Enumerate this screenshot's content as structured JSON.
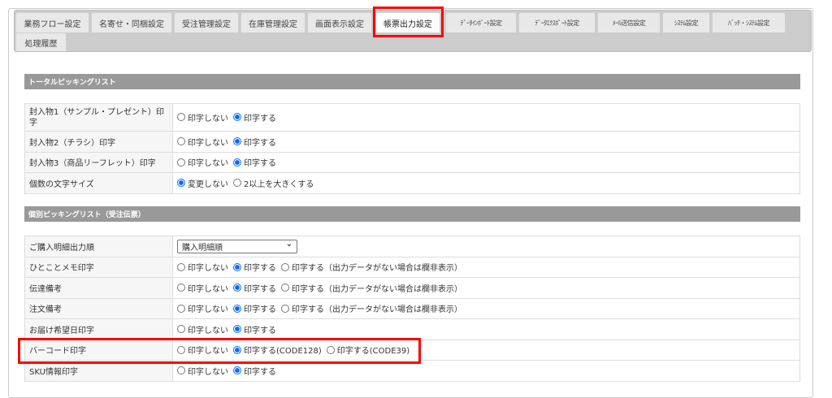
{
  "tabs": [
    {
      "label": "業務フロー設定"
    },
    {
      "label": "名寄せ・同梱設定"
    },
    {
      "label": "受注管理設定"
    },
    {
      "label": "在庫管理設定"
    },
    {
      "label": "画面表示設定"
    },
    {
      "label": "帳票出力設定",
      "active": true
    },
    {
      "label": "ﾃﾞｰﾀｲﾝﾎﾟｰﾄ設定"
    },
    {
      "label": "ﾃﾞｰﾀｴｸｽﾎﾟｰﾄ設定"
    },
    {
      "label": "ﾒｰﾙ送信設定"
    },
    {
      "label": "ｼｽﾃﾑ設定"
    },
    {
      "label": "ﾊﾞｯﾁ・ｼｽﾃﾑ設定"
    },
    {
      "label": "処理履歴"
    }
  ],
  "section1": {
    "title": "トータルピッキングリスト",
    "rows": [
      {
        "label": "封入物1（サンプル・プレゼント）印字",
        "options": [
          "印字しない",
          "印字する"
        ],
        "selected": 1
      },
      {
        "label": "封入物2（チラシ）印字",
        "options": [
          "印字しない",
          "印字する"
        ],
        "selected": 1
      },
      {
        "label": "封入物3（商品リーフレット）印字",
        "options": [
          "印字しない",
          "印字する"
        ],
        "selected": 1
      },
      {
        "label": "個数の文字サイズ",
        "options": [
          "変更しない",
          "2以上を大きくする"
        ],
        "selected": 0
      }
    ]
  },
  "section2": {
    "title": "個別ピッキングリスト（受注伝票）",
    "rows": [
      {
        "label": "ご購入明細出力順",
        "select": "購入明細順"
      },
      {
        "label": "ひとことメモ印字",
        "options": [
          "印字しない",
          "印字する",
          "印字する（出力データがない場合は欄非表示）"
        ],
        "selected": 1
      },
      {
        "label": "伝達備考",
        "options": [
          "印字しない",
          "印字する",
          "印字する（出力データがない場合は欄非表示）"
        ],
        "selected": 1
      },
      {
        "label": "注文備考",
        "options": [
          "印字しない",
          "印字する",
          "印字する（出力データがない場合は欄非表示）"
        ],
        "selected": 1
      },
      {
        "label": "お届け希望日印字",
        "options": [
          "印字しない",
          "印字する"
        ],
        "selected": 1
      },
      {
        "label": "バーコード印字",
        "options": [
          "印字しない",
          "印字する(CODE128)",
          "印字する(CODE39)"
        ],
        "selected": 1
      },
      {
        "label": "SKU情報印字",
        "options": [
          "印字しない",
          "印字する"
        ],
        "selected": 1
      }
    ]
  }
}
